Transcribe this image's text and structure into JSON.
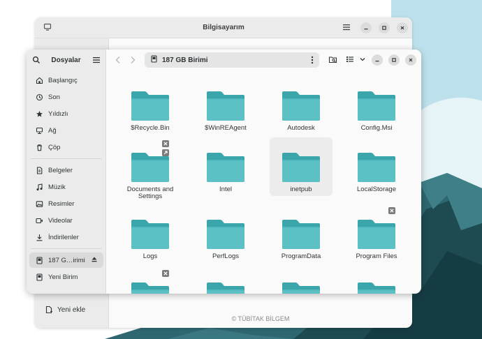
{
  "back_window": {
    "title": "Bilgisayarım",
    "partial_header_text": "",
    "sidebar_footer_label": "Yeni ekle",
    "footer_text": "© TÜBİTAK BİLGEM"
  },
  "front_window": {
    "app_title": "Dosyalar",
    "location": "187 GB Birimi",
    "sidebar": {
      "places": [
        {
          "label": "Başlangıç",
          "icon": "home-icon"
        },
        {
          "label": "Son",
          "icon": "clock-icon"
        },
        {
          "label": "Yıldızlı",
          "icon": "star-icon"
        },
        {
          "label": "Ağ",
          "icon": "network-icon"
        },
        {
          "label": "Çöp",
          "icon": "trash-icon"
        }
      ],
      "bookmarks": [
        {
          "label": "Belgeler",
          "icon": "document-icon"
        },
        {
          "label": "Müzik",
          "icon": "music-icon"
        },
        {
          "label": "Resimler",
          "icon": "picture-icon"
        },
        {
          "label": "Videolar",
          "icon": "video-icon"
        },
        {
          "label": "İndirilenler",
          "icon": "download-icon"
        }
      ],
      "devices": [
        {
          "label": "187 G…irimi",
          "icon": "drive-icon",
          "active": true
        },
        {
          "label": "Yeni Birim",
          "icon": "drive-icon",
          "active": false
        }
      ]
    },
    "folders": [
      {
        "name": "$Recycle.Bin"
      },
      {
        "name": "$WinREAgent"
      },
      {
        "name": "Autodesk"
      },
      {
        "name": "Config.Msi"
      },
      {
        "name": "Documents and Settings"
      },
      {
        "name": "Intel"
      },
      {
        "name": "inetpub"
      },
      {
        "name": "LocalStorage"
      },
      {
        "name": "Logs"
      },
      {
        "name": "PerfLogs"
      },
      {
        "name": "ProgramData"
      },
      {
        "name": "Program Files"
      },
      {
        "name": ""
      },
      {
        "name": ""
      },
      {
        "name": ""
      },
      {
        "name": ""
      }
    ]
  },
  "colors": {
    "folder_back": "#3aa6ac",
    "folder_front": "#5bc1c5",
    "folder_tab": "#46b0b6",
    "mountain_dark": "#1e4a52",
    "mountain_mid": "#2f6770",
    "sky": "#bde1ec"
  }
}
